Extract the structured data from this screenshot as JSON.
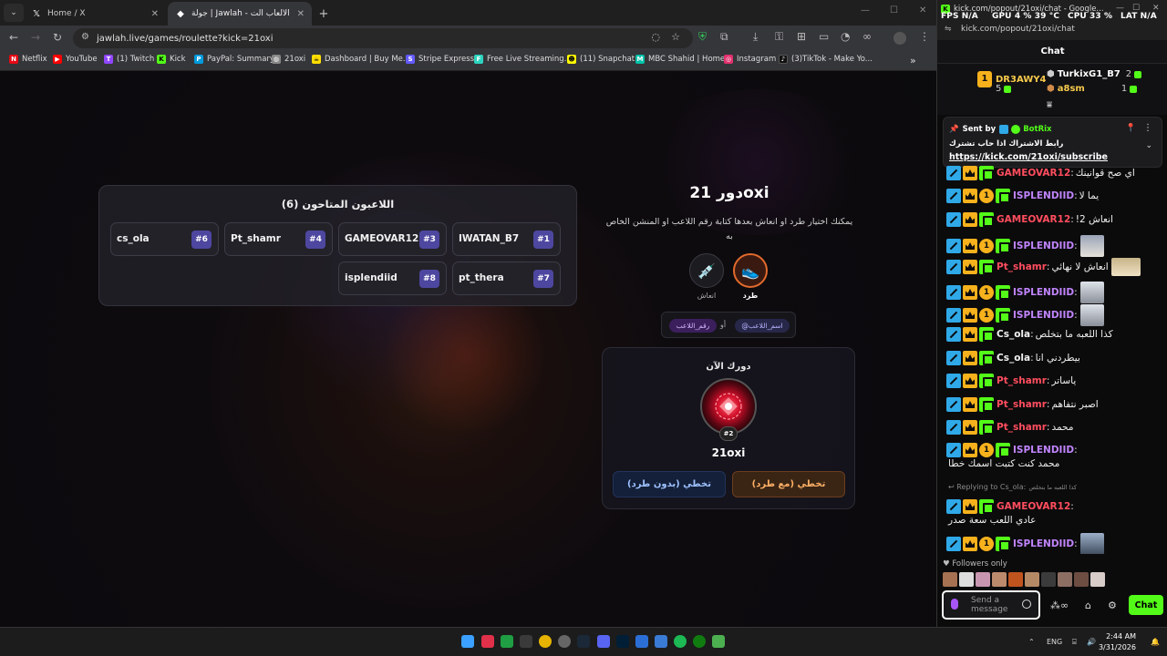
{
  "browser": {
    "tabs": [
      {
        "title": "Home / X",
        "icon": "x-logo-icon",
        "close": "✕"
      },
      {
        "title": "جولة | Jawlah - منصة الألعاب الت...",
        "icon": "jawlah-favicon-icon",
        "close": "✕"
      }
    ],
    "new_tab": "+",
    "url": "jawlah.live/games/roulette?kick=21oxi",
    "bookmarks": [
      {
        "label": "Netflix",
        "color": "#e50914",
        "glyph": "N"
      },
      {
        "label": "YouTube",
        "color": "#ff0000",
        "glyph": "▶"
      },
      {
        "label": "(1) Twitch",
        "color": "#9146ff",
        "glyph": "T"
      },
      {
        "label": "Kick",
        "color": "#53fc18",
        "glyph": "K"
      },
      {
        "label": "PayPal: Summary",
        "color": "#009cde",
        "glyph": "P"
      },
      {
        "label": "21oxi",
        "color": "#888888",
        "glyph": "◍"
      },
      {
        "label": "Dashboard | Buy Me...",
        "color": "#ffdd00",
        "glyph": "☕"
      },
      {
        "label": "Stripe Express",
        "color": "#635bff",
        "glyph": "S"
      },
      {
        "label": "Free Live Streaming...",
        "color": "#2dd4bf",
        "glyph": "F"
      },
      {
        "label": "(11) Snapchat",
        "color": "#fffc00",
        "glyph": "👻"
      },
      {
        "label": "MBC Shahid | Home",
        "color": "#00c2a8",
        "glyph": "M"
      },
      {
        "label": "Instagram",
        "color": "#e1306c",
        "glyph": "◎"
      },
      {
        "label": "(3)TikTok - Make Yo...",
        "color": "#111111",
        "glyph": "♪"
      }
    ],
    "bookmarks_more": "»"
  },
  "game": {
    "players_title": "اللاعبون المتاحون (6)",
    "players": [
      {
        "name": "IWATAN_B7",
        "num": "#1"
      },
      {
        "name": "GAMEOVAR12",
        "num": "#3"
      },
      {
        "name": "Pt_shamr",
        "num": "#4"
      },
      {
        "name": "cs_ola",
        "num": "#6"
      },
      {
        "name": "pt_thera",
        "num": "#7"
      },
      {
        "name": "isplendiid",
        "num": "#8"
      }
    ],
    "turn_title": "دور 21oxi",
    "instructions": "يمكنك اختيار طرد او انعاش بعدها كتابة رقم اللاعب او المنشن الخاص به",
    "actions": [
      {
        "label": "طرد",
        "icon": "kick-shoe-icon",
        "glyph": "👟"
      },
      {
        "label": "انعاش",
        "icon": "syringe-icon",
        "glyph": "💉"
      }
    ],
    "hint_mention": "@اسم_اللاعب",
    "hint_or": "أو",
    "hint_number": "رقم_اللاعب",
    "turn_box_title": "دورك الآن",
    "current_player": "21oxi",
    "current_badge": "#2",
    "btn_with_kick": "تخطي (مع طرد)",
    "btn_without_kick": "تخطي (بدون طرد)"
  },
  "popout": {
    "window_title": "kick.com/popout/21oxi/chat - Google...",
    "overlay": {
      "fps": "FPS  N/A",
      "gpu": "GPU  4 %  39 °C",
      "cpu": "CPU  33 %",
      "lat": "LAT  N/A"
    },
    "url": "kick.com/popout/21oxi/chat",
    "chat_title": "Chat",
    "leaderboard": [
      {
        "name": "DR3AWY4",
        "value": "5"
      },
      {
        "name": "TurkixG1_B7",
        "value": "2"
      },
      {
        "name": "a8sm",
        "value": "1"
      }
    ],
    "pinned": {
      "sent_by": "Sent by",
      "bot": "BotRix",
      "text": "رابط الاشتراك اذا حاب تشترك",
      "link": "https://kick.com/21oxi/subscribe"
    },
    "messages": [
      {
        "user": "GAMEOVAR12",
        "color": "#ff4d5e",
        "badges": [
          "mod",
          "vip",
          "sub"
        ],
        "text": "اي صح قوانينك",
        "emote": ""
      },
      {
        "user": "ISPLENDIID",
        "color": "#c084fc",
        "badges": [
          "mod",
          "vip",
          "one",
          "sub"
        ],
        "text": "يما لا",
        "emote": ""
      },
      {
        "user": "GAMEOVAR12",
        "color": "#ff4d5e",
        "badges": [
          "mod",
          "vip",
          "sub"
        ],
        "text": "انعاش 2!",
        "emote": ""
      },
      {
        "user": "ISPLENDIID",
        "color": "#c084fc",
        "badges": [
          "mod",
          "vip",
          "one",
          "sub"
        ],
        "text": "",
        "emote": "face"
      },
      {
        "user": "Pt_shamr",
        "color": "#ff4d5e",
        "badges": [
          "mod",
          "vip",
          "sub"
        ],
        "text": "انعاش لا نهائي",
        "emote": "hands"
      },
      {
        "user": "ISPLENDIID",
        "color": "#c084fc",
        "badges": [
          "mod",
          "vip",
          "one",
          "sub"
        ],
        "text": "",
        "emote": "man"
      },
      {
        "user": "ISPLENDIID",
        "color": "#c084fc",
        "badges": [
          "mod",
          "vip",
          "one",
          "sub"
        ],
        "text": "",
        "emote": "man"
      },
      {
        "user": "Cs_ola",
        "color": "#f0f0f0",
        "badges": [
          "mod",
          "vip",
          "sub"
        ],
        "text": "كذا اللعبه ما بتخلص",
        "emote": ""
      },
      {
        "user": "Cs_ola",
        "color": "#f0f0f0",
        "badges": [
          "mod",
          "vip",
          "sub"
        ],
        "text": "بيطردني انا",
        "emote": ""
      },
      {
        "user": "Pt_shamr",
        "color": "#ff4d5e",
        "badges": [
          "mod",
          "vip",
          "sub"
        ],
        "text": "ياساتر",
        "emote": ""
      },
      {
        "user": "Pt_shamr",
        "color": "#ff4d5e",
        "badges": [
          "mod",
          "vip",
          "sub"
        ],
        "text": "اصبر نتفاهم",
        "emote": ""
      },
      {
        "user": "Pt_shamr",
        "color": "#ff4d5e",
        "badges": [
          "mod",
          "vip",
          "sub"
        ],
        "text": "محمد",
        "emote": ""
      },
      {
        "user": "ISPLENDIID",
        "color": "#c084fc",
        "badges": [
          "mod",
          "vip",
          "one",
          "sub"
        ],
        "text": "محمد كنت كتبت اسمك خطا",
        "emote": ""
      },
      {
        "user": "GAMEOVAR12",
        "color": "#ff4d5e",
        "badges": [
          "mod",
          "vip",
          "sub"
        ],
        "text": "عادي اللعب سعة صدر",
        "emote": ""
      },
      {
        "user": "ISPLENDIID",
        "color": "#c084fc",
        "badges": [
          "mod",
          "vip",
          "one",
          "sub"
        ],
        "text": "",
        "emote": "suit"
      }
    ],
    "reply_prefix": "Replying to Cs_ola:",
    "reply_quote": "كذا اللعبه ما بتخلص",
    "followers_only": "Followers only",
    "input_placeholder": "Send a message",
    "chat_button": "Chat"
  },
  "taskbar": {
    "lang": "ENG",
    "time": "2:44 AM",
    "date": "3/31/2026"
  }
}
